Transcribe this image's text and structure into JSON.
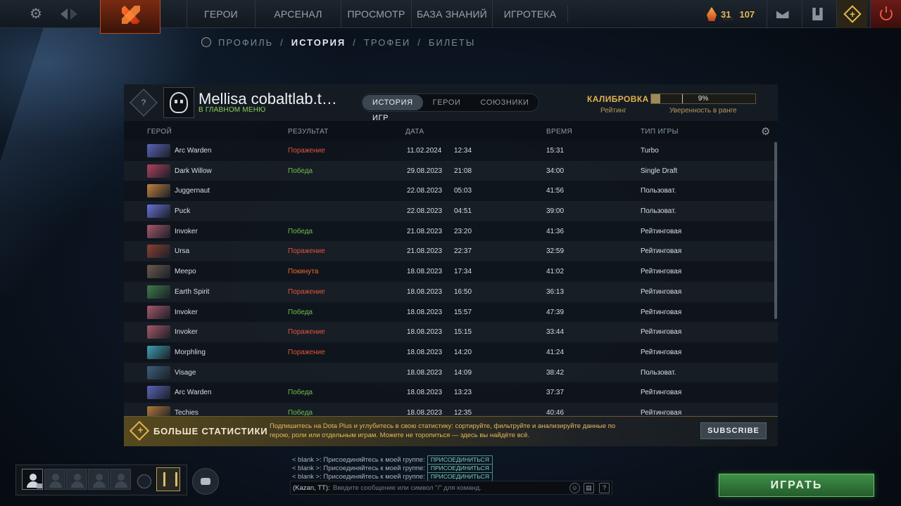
{
  "topnav": {
    "items": [
      "ГЕРОИ",
      "АРСЕНАЛ",
      "ПРОСМОТР",
      "БАЗА ЗНАНИЙ",
      "ИГРОТЕКА"
    ],
    "resources": {
      "shards": "31",
      "gold": "107"
    }
  },
  "subnav": {
    "items": [
      "ПРОФИЛЬ",
      "ИСТОРИЯ",
      "ТРОФЕИ",
      "БИЛЕТЫ"
    ],
    "separator": "/"
  },
  "profile": {
    "rank_badge": "?",
    "name": "Mellisa cobaltlab.t…",
    "status": "В ГЛАВНОМ МЕНЮ",
    "tabs": [
      "ИСТОРИЯ ИГР",
      "ГЕРОИ",
      "СОЮЗНИКИ"
    ],
    "calibration": {
      "label": "КАЛИБРОВКА",
      "rating_label": "Рейтинг",
      "progress": 0.09,
      "progress_label": "9%",
      "confidence_label": "Уверенность в ранге"
    }
  },
  "table": {
    "headers": [
      "ГЕРОЙ",
      "РЕЗУЛЬТАТ",
      "ДАТА",
      "ВРЕМЯ",
      "ТИП ИГРЫ"
    ],
    "rows": [
      {
        "hero": "Arc Warden",
        "color": "#5b63b8",
        "result": "Поражение",
        "res_class": "loss",
        "date": "11.02.2024",
        "time": "12:34",
        "duration": "15:31",
        "type": "Turbo"
      },
      {
        "hero": "Dark Willow",
        "color": "#b0415c",
        "result": "Победа",
        "res_class": "win",
        "date": "29.08.2023",
        "time": "21:08",
        "duration": "34:00",
        "type": "Single Draft"
      },
      {
        "hero": "Juggernaut",
        "color": "#c2813e",
        "result": "",
        "res_class": "",
        "date": "22.08.2023",
        "time": "05:03",
        "duration": "41:56",
        "type": "Пользоват."
      },
      {
        "hero": "Puck",
        "color": "#6a71d8",
        "result": "",
        "res_class": "",
        "date": "22.08.2023",
        "time": "04:51",
        "duration": "39:00",
        "type": "Пользоват."
      },
      {
        "hero": "Invoker",
        "color": "#a8586a",
        "result": "Победа",
        "res_class": "win",
        "date": "21.08.2023",
        "time": "23:20",
        "duration": "41:36",
        "type": "Рейтинговая"
      },
      {
        "hero": "Ursa",
        "color": "#8a4030",
        "result": "Поражение",
        "res_class": "loss",
        "date": "21.08.2023",
        "time": "22:37",
        "duration": "32:59",
        "type": "Рейтинговая"
      },
      {
        "hero": "Meepo",
        "color": "#6c5a4e",
        "result": "Покинута",
        "res_class": "aband",
        "date": "18.08.2023",
        "time": "17:34",
        "duration": "41:02",
        "type": "Рейтинговая"
      },
      {
        "hero": "Earth Spirit",
        "color": "#3f7b4a",
        "result": "Поражение",
        "res_class": "loss",
        "date": "18.08.2023",
        "time": "16:50",
        "duration": "36:13",
        "type": "Рейтинговая"
      },
      {
        "hero": "Invoker",
        "color": "#a8586a",
        "result": "Победа",
        "res_class": "win",
        "date": "18.08.2023",
        "time": "15:57",
        "duration": "47:39",
        "type": "Рейтинговая"
      },
      {
        "hero": "Invoker",
        "color": "#a8586a",
        "result": "Поражение",
        "res_class": "loss",
        "date": "18.08.2023",
        "time": "15:15",
        "duration": "33:44",
        "type": "Рейтинговая"
      },
      {
        "hero": "Morphling",
        "color": "#3f9fb4",
        "result": "Поражение",
        "res_class": "loss",
        "date": "18.08.2023",
        "time": "14:20",
        "duration": "41:24",
        "type": "Рейтинговая"
      },
      {
        "hero": "Visage",
        "color": "#3c5f7c",
        "result": "",
        "res_class": "",
        "date": "18.08.2023",
        "time": "14:09",
        "duration": "38:42",
        "type": "Пользоват."
      },
      {
        "hero": "Arc Warden",
        "color": "#5b63b8",
        "result": "Победа",
        "res_class": "win",
        "date": "18.08.2023",
        "time": "13:23",
        "duration": "37:37",
        "type": "Рейтинговая"
      },
      {
        "hero": "Techies",
        "color": "#b5783c",
        "result": "Победа",
        "res_class": "win",
        "date": "18.08.2023",
        "time": "12:35",
        "duration": "40:46",
        "type": "Рейтинговая"
      }
    ]
  },
  "plus": {
    "title": "БОЛЬШЕ СТАТИСТИКИ",
    "desc": "Подпишитесь на Dota Plus и углубитесь в свою статистику: сортируйте, фильтруйте и анализируйте данные по герою, роли или отдельным играм. Можете не торопиться — здесь вы найдёте всё.",
    "button": "SUBSCRIBE"
  },
  "chat": {
    "lines": [
      {
        "text": "< blank >: Присоединяйтесь к моей группе:",
        "join": "ПРИСОЕДИНИТЬСЯ"
      },
      {
        "text": "< blank >: Присоединяйтесь к моей группе:",
        "join": "ПРИСОЕДИНИТЬСЯ"
      },
      {
        "text": "< blank >: Присоединяйтесь к моей группе:",
        "join": "ПРИСОЕДИНИТЬСЯ"
      }
    ],
    "channel": "(Kazan, TT):",
    "placeholder": "Введите сообщение или символ \"/\" для команд.",
    "help": "?"
  },
  "play_button": "ИГРАТЬ"
}
